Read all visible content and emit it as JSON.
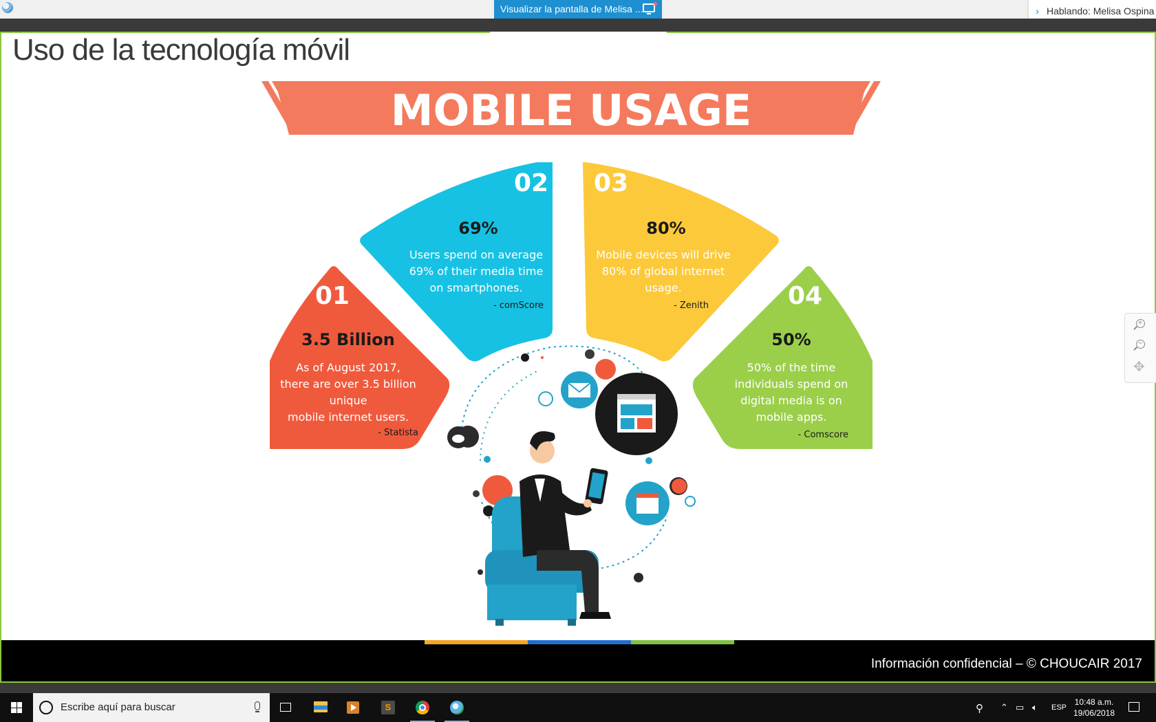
{
  "share_bar": {
    "viewing_label": "Visualizar la pantalla de Melisa ...",
    "speaker_label": "Hablando: Melisa Ospina"
  },
  "slide": {
    "title": "Uso de la tecnología móvil",
    "footer": "Información confidencial – © CHOUCAIR 2017",
    "footer_stripe_colors": [
      "#f5a623",
      "#1f6fd1",
      "#7fc241"
    ]
  },
  "infographic": {
    "banner": "MOBILE USAGE",
    "cards": [
      {
        "number": "01",
        "headline": "3.5 Billion",
        "lines": [
          "As of August 2017,",
          "there are over 3.5 billion",
          "unique",
          "mobile internet users."
        ],
        "source": "- Statista",
        "color": "#f05a3c"
      },
      {
        "number": "02",
        "headline": "69%",
        "lines": [
          "Users spend on average",
          "69% of their media time",
          "on smartphones."
        ],
        "source": "- comScore",
        "color": "#17c1e3"
      },
      {
        "number": "03",
        "headline": "80%",
        "lines": [
          "Mobile devices will drive",
          "80% of global internet",
          "usage."
        ],
        "source": "- Zenith",
        "color": "#fcc93a"
      },
      {
        "number": "04",
        "headline": "50%",
        "lines": [
          "50% of the time",
          "individuals spend on",
          "digital media is on",
          "mobile apps."
        ],
        "source": "- Comscore",
        "color": "#9bcf4a"
      }
    ]
  },
  "taskbar": {
    "search_placeholder": "Escribe aquí para buscar",
    "sublime_letter": "S",
    "language": "ESP",
    "time": "10:48 a.m.",
    "date": "19/06/2018"
  }
}
